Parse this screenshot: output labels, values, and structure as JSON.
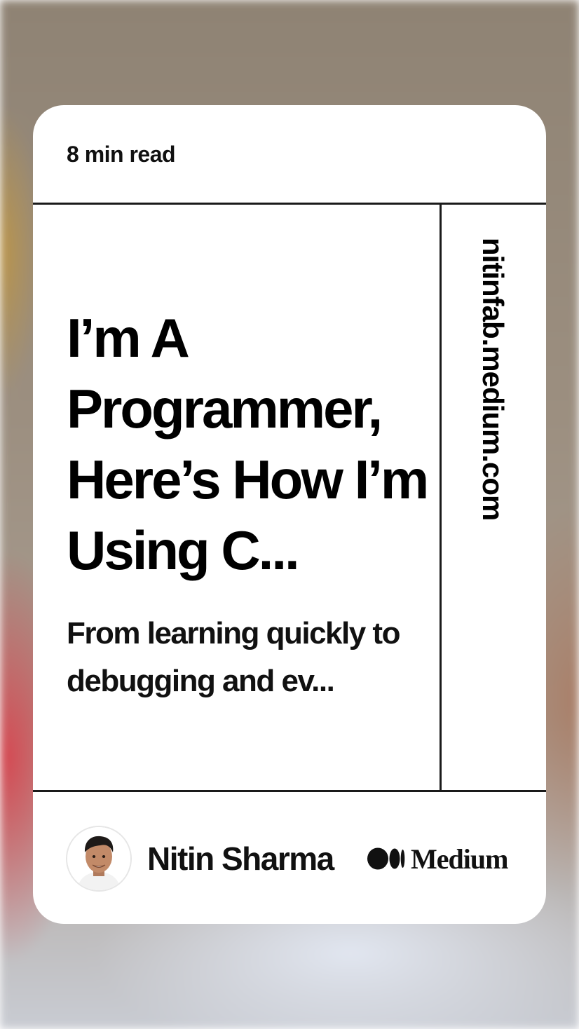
{
  "card": {
    "read_time": "8 min read",
    "title": "I’m A Programmer, Here’s How I’m Using C...",
    "subtitle": "From learning quickly to debugging and ev...",
    "domain": "nitinfab.medium.com"
  },
  "footer": {
    "author_name": "Nitin Sharma",
    "avatar_icon": "author-photo",
    "brand_logo_icon": "medium-logo-icon",
    "brand_name": "Medium"
  },
  "colors": {
    "card_background": "#ffffff",
    "text": "#000000",
    "divider": "#1a1a1a"
  }
}
